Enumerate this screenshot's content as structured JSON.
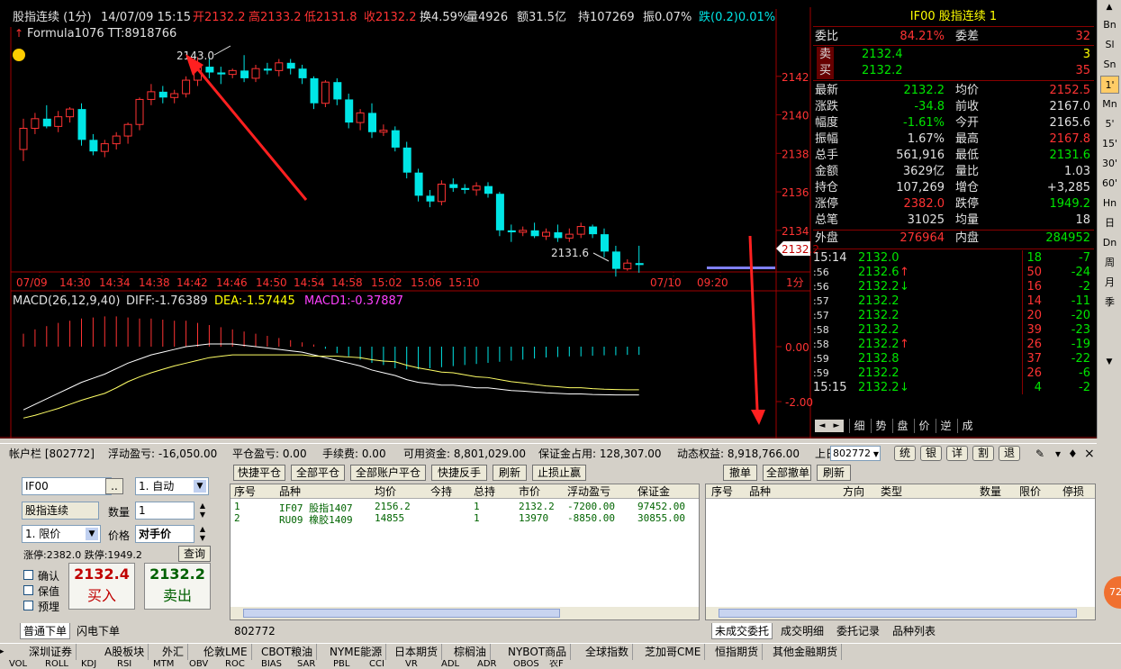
{
  "header": {
    "line1": [
      "股指连续 (1分)",
      "14/07/09 15:15",
      "开2132.2",
      "高2133.2",
      "低2131.8",
      "收2132.2",
      "换4.59%",
      "量4926",
      "额31.5亿",
      "持107269",
      "振0.07%",
      "跌(0.2)0.01%"
    ],
    "line2": "Formula1076 TT:8918766"
  },
  "chart_data": {
    "type": "candlestick",
    "price_ticks": [
      "2142",
      "2140",
      "2138",
      "2136",
      "2134"
    ],
    "time_ticks": [
      "07/09",
      "14:30",
      "14:34",
      "14:38",
      "14:42",
      "14:46",
      "14:50",
      "14:54",
      "14:58",
      "15:02",
      "15:06",
      "15:10",
      "07/10",
      "09:20"
    ],
    "annotations": {
      "high": "2143.0",
      "low": "2131.6"
    },
    "last_price_tag": "2132.2",
    "period_label": "1分",
    "candles": [
      [
        2138.2,
        2139.8,
        2137.6,
        2139.3
      ],
      [
        2139.3,
        2140.1,
        2139.0,
        2139.8
      ],
      [
        2139.8,
        2140.5,
        2139.3,
        2139.4
      ],
      [
        2139.4,
        2140.2,
        2139.1,
        2139.9
      ],
      [
        2139.9,
        2140.4,
        2139.6,
        2140.3
      ],
      [
        2140.3,
        2140.6,
        2138.4,
        2138.7
      ],
      [
        2138.7,
        2139.0,
        2137.9,
        2138.1
      ],
      [
        2138.1,
        2138.7,
        2137.8,
        2138.5
      ],
      [
        2138.5,
        2139.1,
        2138.2,
        2138.9
      ],
      [
        2138.9,
        2139.6,
        2138.5,
        2139.5
      ],
      [
        2139.5,
        2140.9,
        2139.2,
        2140.8
      ],
      [
        2140.8,
        2141.6,
        2140.5,
        2141.2
      ],
      [
        2141.2,
        2141.5,
        2140.6,
        2140.9
      ],
      [
        2140.9,
        2141.3,
        2140.6,
        2141.1
      ],
      [
        2141.1,
        2142.0,
        2140.9,
        2141.8
      ],
      [
        2141.8,
        2143.0,
        2141.5,
        2142.5
      ],
      [
        2142.5,
        2142.9,
        2141.9,
        2142.2
      ],
      [
        2142.2,
        2142.5,
        2141.6,
        2142.1
      ],
      [
        2142.1,
        2142.4,
        2141.9,
        2142.3
      ],
      [
        2142.3,
        2143.1,
        2141.7,
        2141.9
      ],
      [
        2141.9,
        2142.6,
        2141.7,
        2142.4
      ],
      [
        2142.4,
        2142.7,
        2142.1,
        2142.3
      ],
      [
        2142.3,
        2142.9,
        2142.0,
        2142.7
      ],
      [
        2142.7,
        2142.9,
        2142.1,
        2142.4
      ],
      [
        2142.4,
        2142.6,
        2141.6,
        2141.9
      ],
      [
        2141.9,
        2142.0,
        2140.3,
        2140.6
      ],
      [
        2140.6,
        2141.8,
        2140.4,
        2141.7
      ],
      [
        2141.7,
        2141.9,
        2140.5,
        2140.8
      ],
      [
        2140.8,
        2141.1,
        2139.3,
        2139.6
      ],
      [
        2139.6,
        2140.3,
        2139.2,
        2140.1
      ],
      [
        2140.1,
        2140.6,
        2138.8,
        2139.1
      ],
      [
        2139.1,
        2139.5,
        2138.9,
        2139.2
      ],
      [
        2139.2,
        2139.4,
        2138.1,
        2138.3
      ],
      [
        2138.3,
        2138.6,
        2136.7,
        2137.0
      ],
      [
        2137.0,
        2137.2,
        2135.5,
        2135.8
      ],
      [
        2135.8,
        2136.1,
        2135.2,
        2135.5
      ],
      [
        2135.5,
        2136.6,
        2135.3,
        2136.4
      ],
      [
        2136.4,
        2136.7,
        2136.0,
        2136.2
      ],
      [
        2136.2,
        2136.4,
        2135.9,
        2136.1
      ],
      [
        2136.1,
        2136.5,
        2135.8,
        2136.3
      ],
      [
        2136.3,
        2136.5,
        2135.7,
        2135.9
      ],
      [
        2135.9,
        2136.0,
        2133.7,
        2134.0
      ],
      [
        2134.0,
        2134.3,
        2133.4,
        2133.9
      ],
      [
        2133.9,
        2134.2,
        2133.7,
        2134.0
      ],
      [
        2134.0,
        2134.4,
        2133.6,
        2133.7
      ],
      [
        2133.7,
        2134.1,
        2133.5,
        2133.9
      ],
      [
        2133.9,
        2134.3,
        2133.4,
        2133.6
      ],
      [
        2133.6,
        2134.1,
        2133.4,
        2133.8
      ],
      [
        2133.8,
        2134.4,
        2133.6,
        2134.2
      ],
      [
        2134.2,
        2134.3,
        2133.6,
        2133.8
      ],
      [
        2133.8,
        2134.1,
        2132.6,
        2132.9
      ],
      [
        2132.9,
        2133.2,
        2131.6,
        2132.0
      ],
      [
        2132.0,
        2132.5,
        2131.9,
        2132.3
      ],
      [
        2132.3,
        2133.2,
        2131.8,
        2132.2
      ]
    ]
  },
  "macd": {
    "title": "MACD(26,12,9,40)",
    "diff": "DIFF:-1.76389",
    "dea": "DEA:-1.57445",
    "macd1": "MACD1:-0.37887",
    "ticks": [
      "0.00",
      "-2.00"
    ],
    "bars": [
      0.6,
      0.8,
      0.95,
      1.1,
      1.2,
      1.3,
      1.35,
      1.4,
      1.4,
      1.35,
      1.3,
      1.3,
      1.25,
      1.2,
      1.2,
      1.1,
      1.0,
      0.9,
      0.8,
      0.7,
      0.6,
      0.5,
      0.4,
      0.3,
      0.2,
      0.1,
      -0.1,
      -0.3,
      -0.45,
      -0.6,
      -0.75,
      -0.85,
      -1.0,
      -1.05,
      -1.05,
      -1.0,
      -0.95,
      -0.9,
      -0.85,
      -0.8,
      -0.75,
      -0.7,
      -0.65,
      -0.6,
      -0.55,
      -0.5,
      -0.48,
      -0.45,
      -0.45,
      -0.42,
      -0.4,
      -0.4,
      -0.38,
      -0.38
    ]
  },
  "quote": {
    "title": "IF00  股指连续  1",
    "weibi_label": "委比",
    "weibi": "84.21%",
    "weicha_label": "委差",
    "weicha": "32",
    "sell_label": "卖",
    "sell_price": "2132.4",
    "sell_vol": "3",
    "buy_label": "买",
    "buy_price": "2132.2",
    "buy_vol": "35",
    "rows": [
      [
        "最新",
        "2132.2",
        "均价",
        "2152.5"
      ],
      [
        "涨跌",
        "-34.8",
        "前收",
        "2167.0"
      ],
      [
        "幅度",
        "-1.61%",
        "今开",
        "2165.6"
      ],
      [
        "振幅",
        "1.67%",
        "最高",
        "2167.8"
      ],
      [
        "总手",
        "561,916",
        "最低",
        "2131.6"
      ],
      [
        "金额",
        "3629亿",
        "量比",
        "1.03"
      ],
      [
        "持仓",
        "107,269",
        "增仓",
        "+3,285"
      ],
      [
        "涨停",
        "2382.0",
        "跌停",
        "1949.2"
      ],
      [
        "总笔",
        "31025",
        "均量",
        "18"
      ]
    ],
    "waipan_label": "外盘",
    "waipan": "276964",
    "neipan_label": "内盘",
    "neipan": "284952",
    "ticks": [
      [
        "15:14",
        "2132.0",
        "",
        "18",
        "-7"
      ],
      [
        ":56",
        "2132.6",
        "↑",
        "50",
        "-24"
      ],
      [
        ":56",
        "2132.2",
        "↓",
        "16",
        "-2"
      ],
      [
        ":57",
        "2132.2",
        "",
        "14",
        "-11"
      ],
      [
        ":57",
        "2132.2",
        "",
        "20",
        "-20"
      ],
      [
        ":58",
        "2132.2",
        "",
        "39",
        "-23"
      ],
      [
        ":58",
        "2132.2",
        "↑",
        "26",
        "-19"
      ],
      [
        ":59",
        "2132.8",
        "",
        "37",
        "-22"
      ],
      [
        ":59",
        "2132.2",
        "",
        "26",
        "-6"
      ],
      [
        "15:15",
        "2132.2",
        "↓",
        "4",
        "-2"
      ]
    ],
    "tabs": [
      "细",
      "势",
      "盘",
      "价",
      "逆",
      "成"
    ]
  },
  "sidebar": [
    "Bn",
    "Sl",
    "Sn",
    "1'",
    "Mn",
    "5'",
    "15'",
    "30'",
    "60'",
    "Hn",
    "日",
    "Dn",
    "周",
    "月",
    "季"
  ],
  "account": {
    "items": [
      "帐户栏 [802772]",
      "浮动盈亏: -16,050.00",
      "平仓盈亏: 0.00",
      "手续费: 0.00",
      "可用资金: 8,801,029.00",
      "保证金占用: 128,307.00",
      "动态权益: 8,918,766.00",
      "上日"
    ],
    "account_select": "802772",
    "buttons": [
      "统",
      "银",
      "详",
      "割",
      "退"
    ]
  },
  "order": {
    "symbol": "IF00",
    "dots": "..",
    "mode": "1. 自动",
    "name": "股指连续",
    "qty_label": "数量",
    "qty": "1",
    "price_type": "1. 限价",
    "price_label": "价格",
    "price": "对手价",
    "limit_text": "涨停:2382.0 跌停:1949.2",
    "query": "查询",
    "checks": [
      "确认",
      "保值",
      "预埋"
    ],
    "buy_price": "2132.4",
    "buy_label": "买入",
    "sell_price": "2132.2",
    "sell_label": "卖出",
    "tabs": [
      "普通下单",
      "闪电下单"
    ]
  },
  "positions": {
    "buttons": [
      "快捷平仓",
      "全部平仓",
      "全部账户平仓",
      "快捷反手",
      "刷新",
      "止损止赢"
    ],
    "headers": [
      "序号",
      "品种",
      "均价",
      "今持",
      "总持",
      "市价",
      "浮动盈亏",
      "保证金"
    ],
    "rows": [
      [
        "1",
        "IF07 股指1407",
        "2156.2",
        "",
        "1",
        "2132.2",
        "-7200.00",
        "97452.00"
      ],
      [
        "2",
        "RU09 橡胶1409",
        "14855",
        "",
        "1",
        "13970",
        "-8850.00",
        "30855.00"
      ]
    ],
    "footer": "802772"
  },
  "orders": {
    "buttons": [
      "撤单",
      "全部撤单",
      "刷新"
    ],
    "headers": [
      "序号",
      "品种",
      "方向",
      "类型",
      "数量",
      "限价",
      "停损"
    ],
    "tabs": [
      "未成交委托",
      "成交明细",
      "委托记录",
      "品种列表"
    ]
  },
  "bottombar": [
    "深圳证券",
    "A股板块",
    "外汇",
    "伦敦LME",
    "CBOT粮油",
    "NYME能源",
    "日本期货",
    "棕榈油",
    "NYBOT商品",
    "全球指数",
    "芝加哥CME",
    "恒指期货",
    "其他金融期货"
  ],
  "indbar": [
    "VOL",
    "ROLL",
    "KDJ",
    "RSI",
    "MTM",
    "OBV",
    "ROC",
    "BIAS",
    "SAR",
    "PBL",
    "CCI",
    "VR",
    "ADL",
    "ADR",
    "OBOS",
    "农F"
  ],
  "badge": "72"
}
